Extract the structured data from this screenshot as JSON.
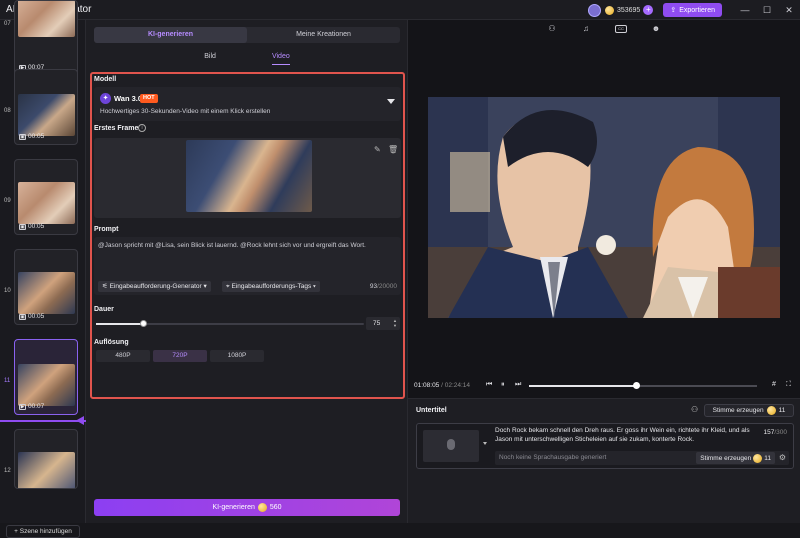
{
  "app": {
    "title": "AI Video Generator",
    "credits": "353695",
    "export_label": "Exportieren"
  },
  "window": {
    "minimize": "—",
    "maximize": "☐",
    "close": "✕"
  },
  "scenes": {
    "items": [
      {
        "num": "07",
        "duration": "00:07"
      },
      {
        "num": "08",
        "duration": "00:05"
      },
      {
        "num": "09",
        "duration": "00:05"
      },
      {
        "num": "10",
        "duration": "00:05"
      },
      {
        "num": "11",
        "duration": "00:07"
      },
      {
        "num": "12",
        "duration": ""
      }
    ],
    "add_label": "+ Szene hinzufügen"
  },
  "panel": {
    "tabs": [
      "KI-generieren",
      "Meine Kreationen"
    ],
    "sub_tabs": [
      "Bild",
      "Video"
    ],
    "model_label": "Modell",
    "model_name": "Wan 3.0",
    "model_badge": "HOT",
    "model_desc": "Hochwertiges 30-Sekunden-Video mit einem Klick erstellen",
    "first_frame_label": "Erstes Frame",
    "prompt_label": "Prompt",
    "prompt_text": "@Jason spricht mit @Lisa, sein Blick ist lauernd. @Rock lehnt sich vor und ergreift das Wort.",
    "prompt_gen_btn": "Eingabeaufforderung-Generator",
    "prompt_tags_btn": "Eingabeaufforderungs-Tags",
    "count_used": "93",
    "count_max": "/20000",
    "duration_label": "Dauer",
    "duration_value": "75",
    "duration_level": 0.18,
    "resolution_label": "Auflösung",
    "resolutions": [
      "480P",
      "720P",
      "1080P"
    ],
    "generate_label": "KI-generieren",
    "generate_cost": "560"
  },
  "player": {
    "time_current": "01:08:05",
    "time_total": " / 02:24:14",
    "progress": 0.47
  },
  "subtitle": {
    "title": "Untertitel",
    "voice_btn": "Stimme erzeugen",
    "voice_cost": "11",
    "text": "Doch Rock bekam schnell den Dreh raus. Er goss ihr Wein ein, richtete ihr Kleid, und als Jason mit unterschwelligen Sticheleien auf sie zukam, konterte Rock.",
    "count_used": "157",
    "count_max": "/300",
    "audio_placeholder": "Noch keine Sprachausgabe generiert",
    "audio_btn": "Stimme erzeugen",
    "audio_cost": "11"
  }
}
